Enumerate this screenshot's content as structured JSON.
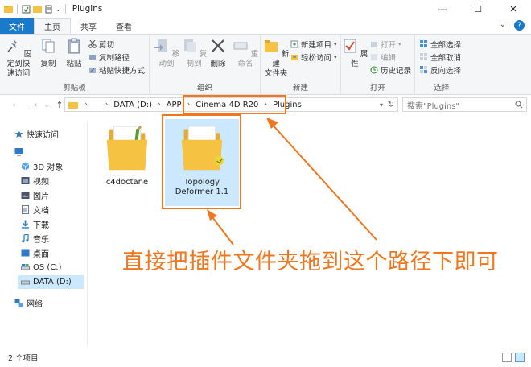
{
  "window": {
    "title": "Plugins",
    "minimize": "—",
    "maximize": "☐",
    "close": "✕"
  },
  "tabs": {
    "file": "文件",
    "items": [
      "主页",
      "共享",
      "查看"
    ],
    "active": "主页"
  },
  "ribbon": {
    "clipboard": {
      "label": "剪贴板",
      "pin": "固定到快\n速访问",
      "copy": "复制",
      "paste": "粘贴",
      "cut": "剪切",
      "copy_path": "复制路径",
      "paste_shortcut": "粘贴快捷方式"
    },
    "organize": {
      "label": "组织",
      "move_to": "移动到",
      "copy_to": "复制到",
      "delete": "删除",
      "rename": "重命名"
    },
    "new": {
      "label": "新建",
      "new_folder": "新建\n文件夹",
      "new_item": "新建项目",
      "easy_access": "轻松访问"
    },
    "open": {
      "label": "打开",
      "properties": "属性",
      "open": "打开",
      "edit": "编辑",
      "history": "历史记录"
    },
    "select": {
      "label": "选择",
      "select_all": "全部选择",
      "select_none": "全部取消",
      "invert": "反向选择"
    }
  },
  "address": {
    "crumbs": [
      "DATA (D:)",
      "APP",
      "Cinema 4D R20",
      "Plugins"
    ],
    "search_placeholder": "搜索\"Plugins\""
  },
  "sidebar": {
    "items": [
      {
        "label": "快速访问",
        "icon": "star-icon",
        "level": 0
      },
      {
        "label": "",
        "icon": "computer-icon",
        "level": 0
      },
      {
        "label": "3D 对象",
        "icon": "cube-icon",
        "level": 1
      },
      {
        "label": "视频",
        "icon": "video-icon",
        "level": 1
      },
      {
        "label": "图片",
        "icon": "picture-icon",
        "level": 1
      },
      {
        "label": "文档",
        "icon": "document-icon",
        "level": 1
      },
      {
        "label": "下载",
        "icon": "download-icon",
        "level": 1
      },
      {
        "label": "音乐",
        "icon": "music-icon",
        "level": 1
      },
      {
        "label": "桌面",
        "icon": "desktop-icon",
        "level": 1
      },
      {
        "label": "OS (C:)",
        "icon": "drive-icon",
        "level": 1
      },
      {
        "label": "DATA (D:)",
        "icon": "drive-icon",
        "level": 1,
        "selected": true
      },
      {
        "label": "网络",
        "icon": "network-icon",
        "level": 0
      }
    ]
  },
  "files": [
    {
      "name": "c4doctane"
    },
    {
      "name": "Topology Deformer 1.1",
      "selected": true
    }
  ],
  "status": {
    "count": "2 个项目"
  },
  "annotation": {
    "text": "直接把插件文件夹拖到这个路径下即可",
    "color": "#f2761d"
  },
  "colors": {
    "accent": "#1979ca",
    "selection": "#cce8ff",
    "folder": "#f5c242"
  }
}
